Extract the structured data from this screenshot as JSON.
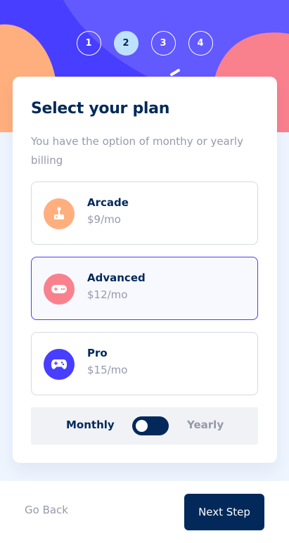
{
  "header": {
    "steps": [
      "1",
      "2",
      "3",
      "4"
    ],
    "active_step": "2"
  },
  "card": {
    "title": "Select your plan",
    "subtitle": "You have the option of monthy or yearly billing"
  },
  "plans": [
    {
      "name": "Arcade",
      "price": "$9/mo",
      "icon": "arcade-icon",
      "color": "#ffaf7e",
      "selected": false
    },
    {
      "name": "Advanced",
      "price": "$12/mo",
      "icon": "gamepad-icon",
      "color": "#f9818e",
      "selected": true
    },
    {
      "name": "Pro",
      "price": "$15/mo",
      "icon": "controller-icon",
      "color": "#483eff",
      "selected": false
    }
  ],
  "billing": {
    "monthly_label": "Monthly",
    "yearly_label": "Yearly",
    "selected": "Monthly"
  },
  "footer": {
    "back_label": "Go Back",
    "next_label": "Next Step"
  },
  "colors": {
    "primary": "#02295a",
    "accent": "#483eff",
    "muted": "#9699ab",
    "background": "#eef5ff"
  }
}
